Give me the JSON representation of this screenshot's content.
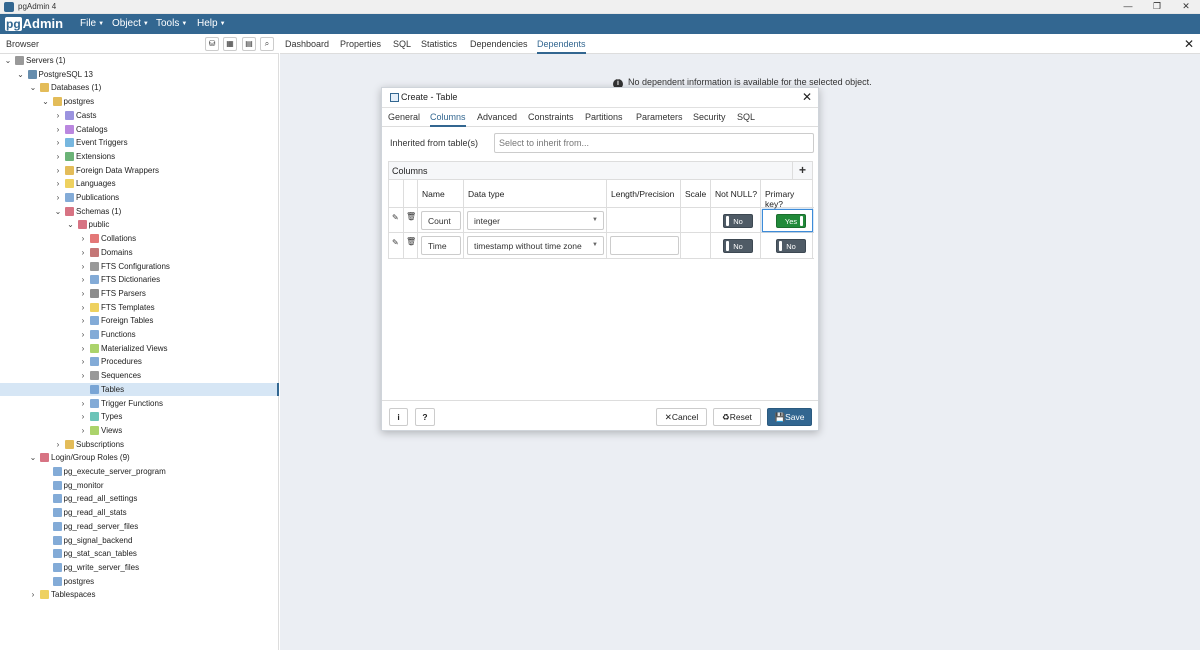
{
  "window": {
    "title": "pgAdmin 4",
    "minimize": "—",
    "restore": "❐",
    "close": "✕"
  },
  "menubar": {
    "brand_pg": "pg",
    "brand_rest": "Admin",
    "items": [
      "File",
      "Object",
      "Tools",
      "Help"
    ]
  },
  "browser": {
    "label": "Browser"
  },
  "tree": [
    {
      "label": "Servers (1)",
      "icon": "servers-icon",
      "color": "#777"
    },
    {
      "label": "PostgreSQL 13",
      "icon": "postgresql-icon",
      "color": "#336791"
    },
    {
      "label": "Databases (1)",
      "icon": "databases-icon",
      "color": "#d9a521"
    },
    {
      "label": "postgres",
      "icon": "database-icon",
      "color": "#d9a521"
    },
    {
      "label": "Casts",
      "icon": "casts-icon",
      "color": "#7a6fd4"
    },
    {
      "label": "Catalogs",
      "icon": "catalogs-icon",
      "color": "#a35fd4"
    },
    {
      "label": "Event Triggers",
      "icon": "event-triggers-icon",
      "color": "#4a9fd4"
    },
    {
      "label": "Extensions",
      "icon": "extensions-icon",
      "color": "#3a9a4a"
    },
    {
      "label": "Foreign Data Wrappers",
      "icon": "fdw-icon",
      "color": "#d9a521"
    },
    {
      "label": "Languages",
      "icon": "languages-icon",
      "color": "#e8c22a"
    },
    {
      "label": "Publications",
      "icon": "publications-icon",
      "color": "#5a8fc9"
    },
    {
      "label": "Schemas (1)",
      "icon": "schemas-icon",
      "color": "#c9445a"
    },
    {
      "label": "public",
      "icon": "schema-icon",
      "color": "#c9445a"
    },
    {
      "label": "Collations",
      "icon": "collations-icon",
      "color": "#d94a4a"
    },
    {
      "label": "Domains",
      "icon": "domains-icon",
      "color": "#b04a4a"
    },
    {
      "label": "FTS Configurations",
      "icon": "fts-config-icon",
      "color": "#777"
    },
    {
      "label": "FTS Dictionaries",
      "icon": "fts-dict-icon",
      "color": "#5a8fc9"
    },
    {
      "label": "FTS Parsers",
      "icon": "fts-parsers-icon",
      "color": "#666"
    },
    {
      "label": "FTS Templates",
      "icon": "fts-templates-icon",
      "color": "#e8c22a"
    },
    {
      "label": "Foreign Tables",
      "icon": "foreign-tables-icon",
      "color": "#5a8fc9"
    },
    {
      "label": "Functions",
      "icon": "functions-icon",
      "color": "#5a8fc9"
    },
    {
      "label": "Materialized Views",
      "icon": "mat-views-icon",
      "color": "#8fc43a"
    },
    {
      "label": "Procedures",
      "icon": "procedures-icon",
      "color": "#5a8fc9"
    },
    {
      "label": "Sequences",
      "icon": "sequences-icon",
      "color": "#777"
    },
    {
      "label": "Tables",
      "icon": "tables-icon",
      "color": "#5a8fc9"
    },
    {
      "label": "Trigger Functions",
      "icon": "trigger-functions-icon",
      "color": "#5a8fc9"
    },
    {
      "label": "Types",
      "icon": "types-icon",
      "color": "#3ab0a0"
    },
    {
      "label": "Views",
      "icon": "views-icon",
      "color": "#8fc43a"
    },
    {
      "label": "Subscriptions",
      "icon": "subscriptions-icon",
      "color": "#d9a521"
    },
    {
      "label": "Login/Group Roles (9)",
      "icon": "roles-icon",
      "color": "#c9445a"
    },
    {
      "label": "pg_execute_server_program",
      "icon": "role-icon",
      "color": "#5a8fc9"
    },
    {
      "label": "pg_monitor",
      "icon": "role-icon",
      "color": "#5a8fc9"
    },
    {
      "label": "pg_read_all_settings",
      "icon": "role-icon",
      "color": "#5a8fc9"
    },
    {
      "label": "pg_read_all_stats",
      "icon": "role-icon",
      "color": "#5a8fc9"
    },
    {
      "label": "pg_read_server_files",
      "icon": "role-icon",
      "color": "#5a8fc9"
    },
    {
      "label": "pg_signal_backend",
      "icon": "role-icon",
      "color": "#5a8fc9"
    },
    {
      "label": "pg_stat_scan_tables",
      "icon": "role-icon",
      "color": "#5a8fc9"
    },
    {
      "label": "pg_write_server_files",
      "icon": "role-icon",
      "color": "#5a8fc9"
    },
    {
      "label": "postgres",
      "icon": "role-icon",
      "color": "#5a8fc9"
    },
    {
      "label": "Tablespaces",
      "icon": "tablespaces-icon",
      "color": "#e8c22a"
    }
  ],
  "main_tabs": [
    "Dashboard",
    "Properties",
    "SQL",
    "Statistics",
    "Dependencies",
    "Dependents"
  ],
  "main_close": "✕",
  "no_dependents": "No dependent information is available for the selected object.",
  "dialog": {
    "title": "Create - Table",
    "close": "✕",
    "tabs": [
      "General",
      "Columns",
      "Advanced",
      "Constraints",
      "Partitions",
      "Parameters",
      "Security",
      "SQL"
    ],
    "inherit_label": "Inherited from table(s)",
    "inherit_placeholder": "Select to inherit from...",
    "columns_label": "Columns",
    "add": "+",
    "headers": [
      "Name",
      "Data type",
      "Length/Precision",
      "Scale",
      "Not NULL?",
      "Primary key?"
    ],
    "rows": [
      {
        "name": "Count",
        "type": "integer",
        "length": "",
        "scale": "",
        "not_null": "No",
        "pk": "Yes"
      },
      {
        "name": "Time",
        "type": "timestamp without time zone",
        "length": "",
        "scale": "",
        "not_null": "No",
        "pk": "No"
      }
    ],
    "info_btn": "i",
    "help_btn": "?",
    "cancel": "Cancel",
    "reset": "Reset",
    "save": "Save"
  }
}
